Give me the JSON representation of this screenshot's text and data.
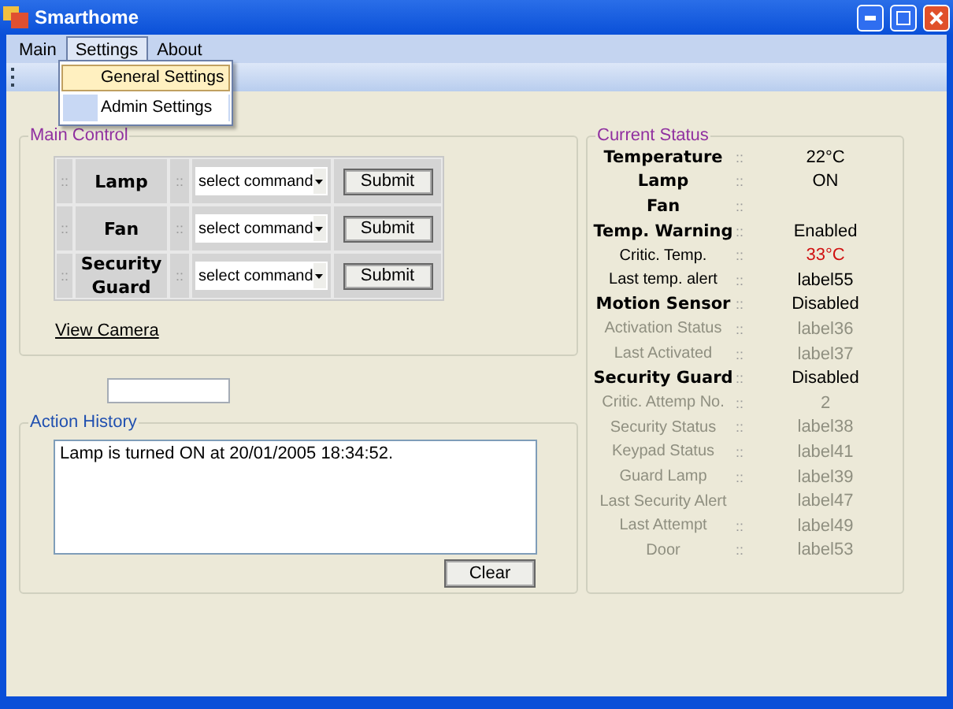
{
  "window": {
    "title": "Smarthome"
  },
  "menu": [
    {
      "label": "Main",
      "selected": false
    },
    {
      "label": "Settings",
      "selected": true
    },
    {
      "label": "About",
      "selected": false
    }
  ],
  "dropdown": [
    {
      "label": "General Settings",
      "selected": true
    },
    {
      "label": "Admin Settings",
      "selected": false
    }
  ],
  "main_control": {
    "title": "Main Control",
    "grip": "::",
    "separator": "::",
    "rows": [
      {
        "device": "Lamp",
        "command": "select command",
        "button": "Submit"
      },
      {
        "device": "Fan",
        "command": "select command",
        "button": "Submit"
      },
      {
        "device": "Security Guard",
        "command": "select command",
        "button": "Submit"
      }
    ],
    "link": "View Camera"
  },
  "action_history": {
    "title": "Action History",
    "log": "Lamp is turned ON at 20/01/2005 18:34:52.",
    "button": "Clear"
  },
  "current_status": {
    "title": "Current Status",
    "rows": [
      {
        "label": "Temperature",
        "separator": "::",
        "value": "22°C",
        "bold": true,
        "disabled": false,
        "alert": false
      },
      {
        "label": "Lamp",
        "separator": "::",
        "value": "ON",
        "bold": true,
        "disabled": false,
        "alert": false
      },
      {
        "label": "Fan",
        "separator": "::",
        "bold": true,
        "disabled": false,
        "alert": false
      },
      {
        "label": "Temp. Warning",
        "separator": "::",
        "value": "Enabled",
        "bold": true,
        "disabled": false,
        "alert": false
      },
      {
        "label": "Critic. Temp.",
        "separator": "::",
        "value": "33°C",
        "bold": false,
        "disabled": false,
        "alert": true
      },
      {
        "label": "Last temp. alert",
        "separator": "::",
        "value": "label55",
        "bold": false,
        "disabled": false,
        "alert": false
      },
      {
        "label": "Motion Sensor",
        "separator": "::",
        "value": "Disabled",
        "bold": true,
        "disabled": false,
        "alert": false
      },
      {
        "label": "Activation Status",
        "separator": "::",
        "value": "label36",
        "bold": false,
        "disabled": true,
        "alert": false
      },
      {
        "label": "Last Activated",
        "separator": "::",
        "value": "label37",
        "bold": false,
        "disabled": true,
        "alert": false
      },
      {
        "label": "Security Guard",
        "separator": "::",
        "value": "Disabled",
        "bold": true,
        "disabled": false,
        "alert": false
      },
      {
        "label": "Critic. Attemp No.",
        "separator": "::",
        "value": "2",
        "bold": false,
        "disabled": true,
        "alert": false
      },
      {
        "label": "Security Status",
        "separator": "::",
        "value": "label38",
        "bold": false,
        "disabled": true,
        "alert": false
      },
      {
        "label": "Keypad Status",
        "separator": "::",
        "value": "label41",
        "bold": false,
        "disabled": true,
        "alert": false
      },
      {
        "label": "Guard Lamp",
        "separator": "::",
        "value": "label39",
        "bold": false,
        "disabled": true,
        "alert": false
      },
      {
        "label": "Last Security Alert",
        "value": "label47",
        "bold": false,
        "disabled": true,
        "alert": false
      },
      {
        "label": "Last Attempt",
        "separator": "::",
        "value": "label49",
        "bold": false,
        "disabled": true,
        "alert": false
      },
      {
        "label": "Door",
        "separator": "::",
        "value": "label53",
        "bold": false,
        "disabled": true,
        "alert": false
      }
    ]
  }
}
